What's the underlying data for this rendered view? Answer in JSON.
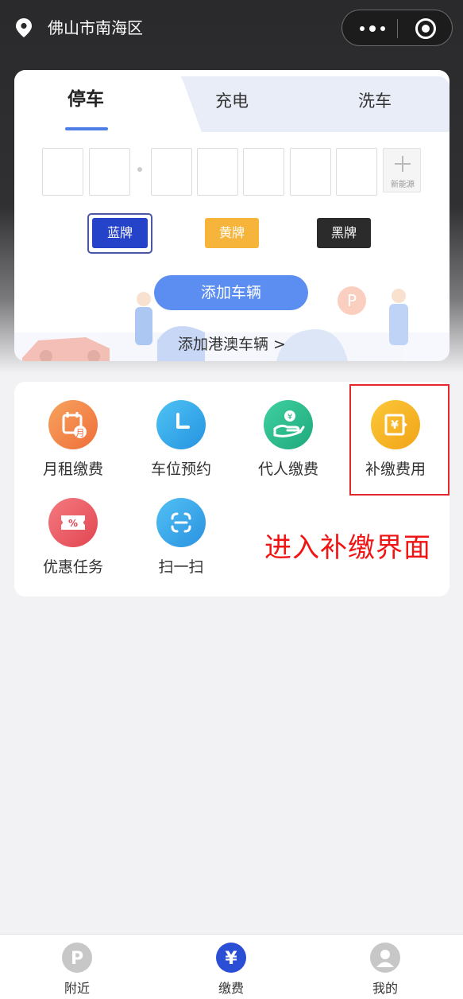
{
  "header": {
    "city": "佛山市南海区",
    "location_icon": "map-pin-icon",
    "more_icon": "more-dots-icon",
    "close_icon": "target-circle-icon"
  },
  "tabs": [
    {
      "label": "停车",
      "active": true
    },
    {
      "label": "充电",
      "active": false
    },
    {
      "label": "洗车",
      "active": false
    }
  ],
  "plate": {
    "new_energy_label": "新能源",
    "colors": [
      {
        "label": "蓝牌",
        "color": "#2443c8",
        "selected": true
      },
      {
        "label": "黄牌",
        "color": "#f6b43a",
        "selected": false
      },
      {
        "label": "黑牌",
        "color": "#2b2b2b",
        "selected": false
      }
    ],
    "add_vehicle": "添加车辆",
    "add_hk_macau": "添加港澳车辆 >"
  },
  "services": [
    {
      "label": "月租缴费",
      "icon": "calendar-month-icon",
      "color": "#f2884a"
    },
    {
      "label": "车位预约",
      "icon": "clock-icon",
      "color": "#35a8ea"
    },
    {
      "label": "代人缴费",
      "icon": "hand-coin-icon",
      "color": "#2bbd8e"
    },
    {
      "label": "补缴费用",
      "icon": "yen-receipt-icon",
      "color": "#f5b323"
    },
    {
      "label": "优惠任务",
      "icon": "coupon-icon",
      "color": "#ee5b63"
    },
    {
      "label": "扫一扫",
      "icon": "scan-icon",
      "color": "#3aa5ea"
    }
  ],
  "annotation": "进入补缴界面",
  "annotation_color": "#f01414",
  "bottom_nav": [
    {
      "label": "附近",
      "icon": "parking-icon",
      "active": false
    },
    {
      "label": "缴费",
      "icon": "yen-icon",
      "active": true
    },
    {
      "label": "我的",
      "icon": "user-icon",
      "active": false
    }
  ]
}
